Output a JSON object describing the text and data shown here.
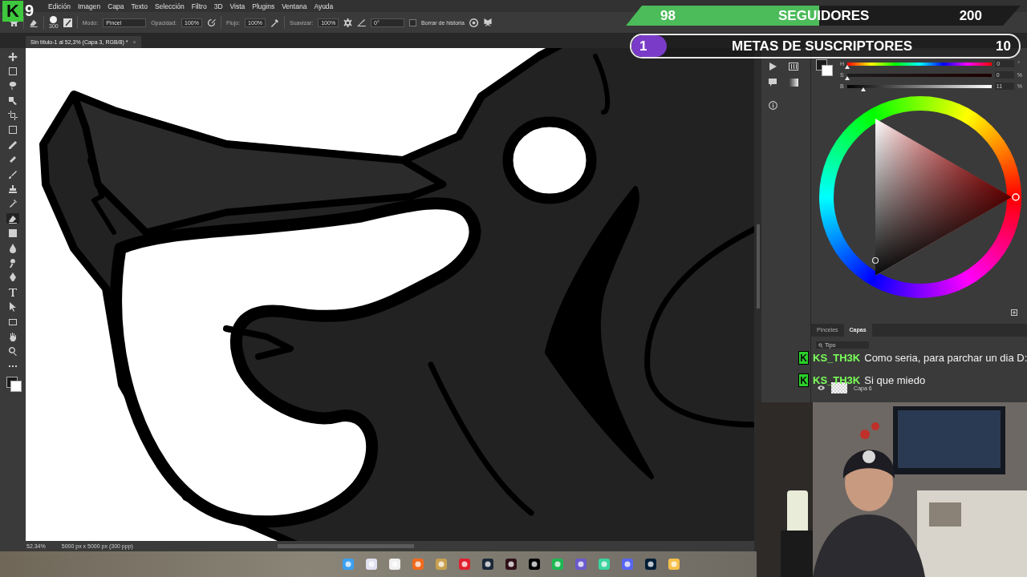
{
  "overlay": {
    "logo": {
      "letter": "K",
      "count": "9"
    },
    "followers": {
      "current": "98",
      "label": "SEGUIDORES",
      "goal": "200",
      "level": 0.49
    },
    "subscribers": {
      "current": "1",
      "label": "METAS DE SUSCRIPTORES",
      "goal": "10",
      "level": 0.09
    },
    "chat": [
      {
        "badge": "K",
        "user": "KS_TH3K",
        "message": "Como seria, para parchar un dia D:"
      },
      {
        "badge": "K",
        "user": "KS_TH3K",
        "message": "Si que miedo"
      }
    ]
  },
  "menu": [
    "Edición",
    "Imagen",
    "Capa",
    "Texto",
    "Selección",
    "Filtro",
    "3D",
    "Vista",
    "Plugins",
    "Ventana",
    "Ayuda"
  ],
  "options": {
    "brush_size": "300",
    "mode_label": "Modo:",
    "mode": "Pincel",
    "opacity_label": "Opacidad:",
    "opacity": "100%",
    "flow_label": "Flujo:",
    "flow": "100%",
    "smoothing_label": "Suavizar:",
    "smoothing": "100%",
    "angle": "0°",
    "erase_history": {
      "label": "Borrar de historia",
      "checked": false
    }
  },
  "document_tab": {
    "title": "Sin título-1 al 52,3% (Capa 3, RGB/8) *",
    "close": "×"
  },
  "tools": [
    {
      "kind": "move",
      "selected": false
    },
    {
      "kind": "marquee",
      "selected": false
    },
    {
      "kind": "lasso",
      "selected": false
    },
    {
      "kind": "select",
      "selected": false
    },
    {
      "kind": "crop",
      "selected": false
    },
    {
      "kind": "frame",
      "selected": false
    },
    {
      "kind": "eyedropper",
      "selected": false
    },
    {
      "kind": "heal",
      "selected": false
    },
    {
      "kind": "brush",
      "selected": false
    },
    {
      "kind": "stamp",
      "selected": false
    },
    {
      "kind": "history",
      "selected": false
    },
    {
      "kind": "eraser",
      "selected": true
    },
    {
      "kind": "gradient",
      "selected": false
    },
    {
      "kind": "blur",
      "selected": false
    },
    {
      "kind": "dodge",
      "selected": false
    },
    {
      "kind": "pen",
      "selected": false
    },
    {
      "kind": "type",
      "selected": false
    },
    {
      "kind": "path",
      "selected": false
    },
    {
      "kind": "shape",
      "selected": false
    },
    {
      "kind": "hand",
      "selected": false
    },
    {
      "kind": "zoom",
      "selected": false
    },
    {
      "kind": "more",
      "selected": false
    }
  ],
  "color_panel": {
    "sliders": [
      {
        "kind": "hue",
        "label": "H",
        "value": "0",
        "unit": "°",
        "level": 0
      },
      {
        "kind": "saturation",
        "label": "S",
        "value": "0",
        "unit": "%",
        "level": 0
      },
      {
        "kind": "brightness",
        "label": "B",
        "value": "11",
        "unit": "%",
        "level": 0.11
      }
    ]
  },
  "layers_panel": {
    "tabs": [
      {
        "label": "Pinceles",
        "selected": false
      },
      {
        "label": "Capas",
        "selected": true
      }
    ],
    "filter": "Tipo",
    "layer": "Capa 6"
  },
  "status": {
    "zoom": "52.34%",
    "size": "5000 px x 5000 px (300 ppp)"
  }
}
